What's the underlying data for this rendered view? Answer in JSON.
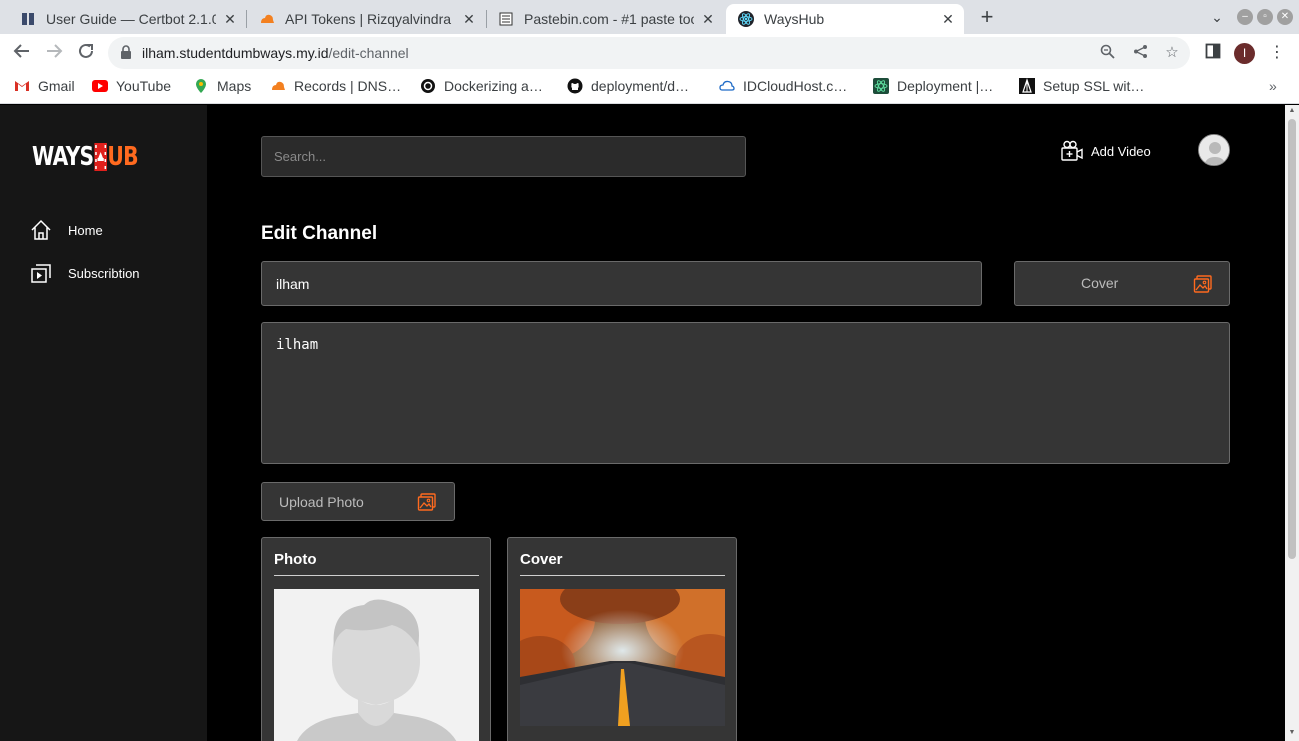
{
  "browser": {
    "tabs": [
      {
        "title": "User Guide — Certbot 2.1.0",
        "favicon": "book-icon"
      },
      {
        "title": "API Tokens | Rizqyalvindra",
        "favicon": "cloudflare-icon"
      },
      {
        "title": "Pastebin.com - #1 paste tool",
        "favicon": "pastebin-icon"
      },
      {
        "title": "WaysHub",
        "favicon": "react-icon",
        "active": true
      }
    ],
    "url_host": "ilham.studentdumbways.my.id",
    "url_path": "/edit-channel",
    "profile_initial": "I",
    "bookmarks": [
      {
        "label": "Gmail",
        "icon": "gmail-icon"
      },
      {
        "label": "YouTube",
        "icon": "youtube-icon"
      },
      {
        "label": "Maps",
        "icon": "maps-icon"
      },
      {
        "label": "Records | DNS…",
        "icon": "cloudflare-icon"
      },
      {
        "label": "Dockerizing a…",
        "icon": "circle-icon"
      },
      {
        "label": "deployment/d…",
        "icon": "github-icon"
      },
      {
        "label": "IDCloudHost.c…",
        "icon": "idcloudhost-icon"
      },
      {
        "label": "Deployment |…",
        "icon": "react-icon"
      },
      {
        "label": "Setup SSL wit…",
        "icon": "tower-icon"
      }
    ]
  },
  "app": {
    "logo_left": "WAYS",
    "logo_right": "UB",
    "nav": [
      {
        "label": "Home",
        "icon": "home-icon"
      },
      {
        "label": "Subscribtion",
        "icon": "subscription-icon"
      }
    ],
    "search_placeholder": "Search...",
    "add_video_label": "Add Video",
    "accent": "#ff6a1f"
  },
  "form": {
    "title": "Edit Channel",
    "name_value": "ilham",
    "cover_label": "Cover",
    "description_value": "ilham",
    "upload_label": "Upload Photo"
  },
  "cards": {
    "photo_title": "Photo",
    "cover_title": "Cover"
  }
}
